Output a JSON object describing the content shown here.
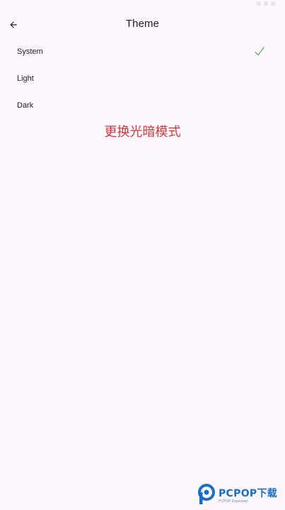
{
  "header": {
    "title": "Theme"
  },
  "options": [
    {
      "label": "System",
      "selected": true
    },
    {
      "label": "Light",
      "selected": false
    },
    {
      "label": "Dark",
      "selected": false
    }
  ],
  "promo": {
    "text": "更换光暗模式"
  },
  "watermark": {
    "brand": "PCPOP下载",
    "sub": "PCPOP Download"
  },
  "colors": {
    "background": "#fdf7fd",
    "check": "#4caf50",
    "promo": "#d03a3a",
    "watermark": "#1a6fc4"
  },
  "icons": {
    "back": "arrow-back-icon",
    "selected": "check-icon"
  }
}
